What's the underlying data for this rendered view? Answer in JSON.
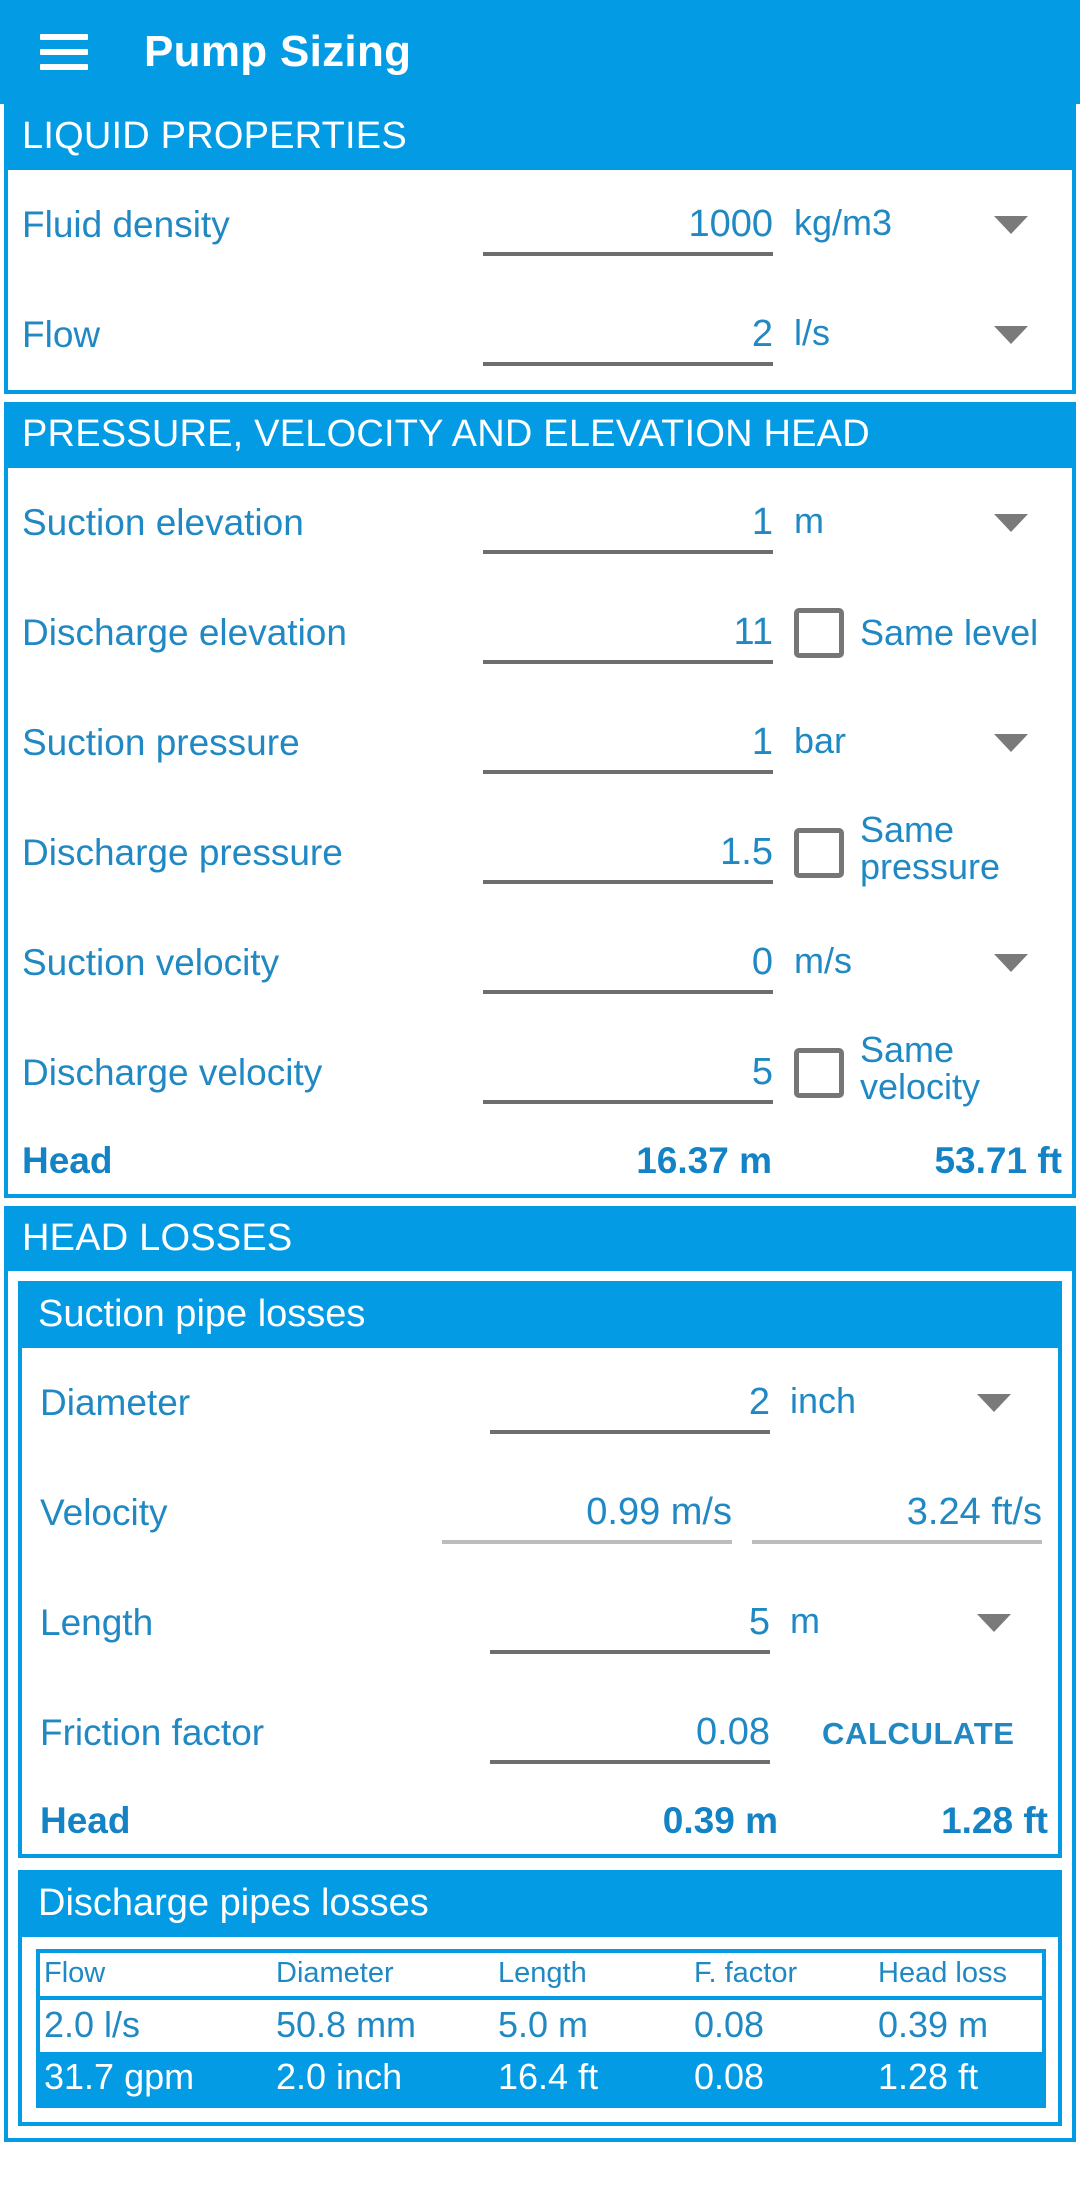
{
  "app": {
    "title": "Pump Sizing",
    "menu_icon": "hamburger-menu-icon",
    "accent_color": "#049BE5",
    "text_color": "#2089C4"
  },
  "liquid_properties": {
    "header": "LIQUID PROPERTIES",
    "rows": [
      {
        "label": "Fluid density",
        "value": "1000",
        "unit": "kg/m3"
      },
      {
        "label": "Flow",
        "value": "2",
        "unit": "l/s"
      }
    ]
  },
  "pressure_section": {
    "header": "PRESSURE, VELOCITY AND ELEVATION HEAD",
    "rows": [
      {
        "label": "Suction elevation",
        "value": "1",
        "unit": "m"
      },
      {
        "label": "Discharge elevation",
        "value": "11",
        "checkbox_label": "Same level",
        "checked": false
      },
      {
        "label": "Suction pressure",
        "value": "1",
        "unit": "bar"
      },
      {
        "label": "Discharge pressure",
        "value": "1.5",
        "checkbox_label": "Same pressure",
        "checked": false
      },
      {
        "label": "Suction velocity",
        "value": "0",
        "unit": "m/s"
      },
      {
        "label": "Discharge velocity",
        "value": "5",
        "checkbox_label": "Same velocity",
        "checked": false
      }
    ],
    "head": {
      "label": "Head",
      "metric": "16.37 m",
      "imperial": "53.71 ft"
    }
  },
  "head_losses": {
    "header": "HEAD LOSSES",
    "suction": {
      "header": "Suction pipe losses",
      "diameter": {
        "label": "Diameter",
        "value": "2",
        "unit": "inch"
      },
      "velocity": {
        "label": "Velocity",
        "metric": "0.99 m/s",
        "imperial": "3.24 ft/s"
      },
      "length": {
        "label": "Length",
        "value": "5",
        "unit": "m"
      },
      "friction": {
        "label": "Friction factor",
        "value": "0.08",
        "button": "CALCULATE"
      },
      "head": {
        "label": "Head",
        "metric": "0.39 m",
        "imperial": "1.28 ft"
      }
    },
    "discharge": {
      "header": "Discharge pipes losses",
      "table": {
        "columns": [
          "Flow",
          "Diameter",
          "Length",
          "F. factor",
          "Head loss"
        ],
        "rows": [
          [
            "2.0 l/s",
            "50.8 mm",
            "5.0 m",
            "0.08",
            "0.39 m"
          ],
          [
            "31.7 gpm",
            "2.0 inch",
            "16.4 ft",
            "0.08",
            "1.28 ft"
          ]
        ]
      }
    }
  }
}
